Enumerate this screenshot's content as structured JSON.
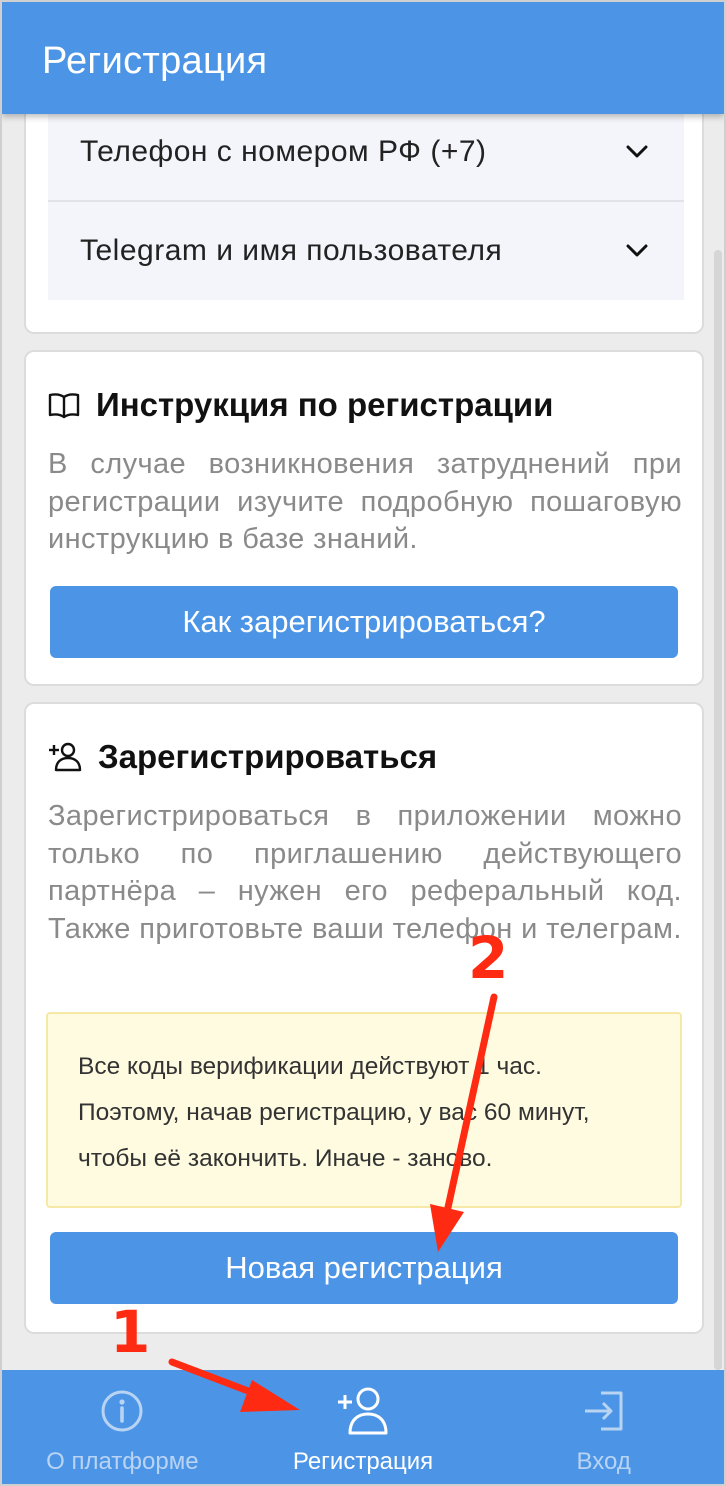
{
  "header": {
    "title": "Регистрация"
  },
  "accordion": {
    "items": [
      {
        "label": "Телефон с номером РФ (+7)"
      },
      {
        "label": "Telegram и имя пользователя"
      }
    ]
  },
  "instructions": {
    "icon": "book-icon",
    "title": "Инструкция по регистрации",
    "text": "В случае возникновения затруднений при регистрации изучите подробную пошаговую инструкцию в базе знаний.",
    "button_label": "Как зарегистрироваться?"
  },
  "register": {
    "icon": "add-user-icon",
    "title": "Зарегистрироваться",
    "text": "Зарегистрироваться в приложении можно только по приглашению действующего партнёра – нужен его реферальный код. Также приготовьте ваши телефон и телеграм.",
    "notice": "Все коды верификации действуют 1 час. Поэтому, начав регистрацию, у вас 60 минут, чтобы её закончить. Иначе - заново.",
    "button_label": "Новая регистрация"
  },
  "tabbar": {
    "tabs": [
      {
        "label": "О платформе",
        "icon": "info-icon",
        "active": false
      },
      {
        "label": "Регистрация",
        "icon": "add-user-icon",
        "active": true
      },
      {
        "label": "Вход",
        "icon": "login-icon",
        "active": false
      }
    ]
  },
  "annotations": {
    "step1": "1",
    "step2": "2"
  },
  "colors": {
    "primary": "#4c95e6",
    "annotation": "#ff2a12",
    "notice_bg": "#fffbe0"
  }
}
